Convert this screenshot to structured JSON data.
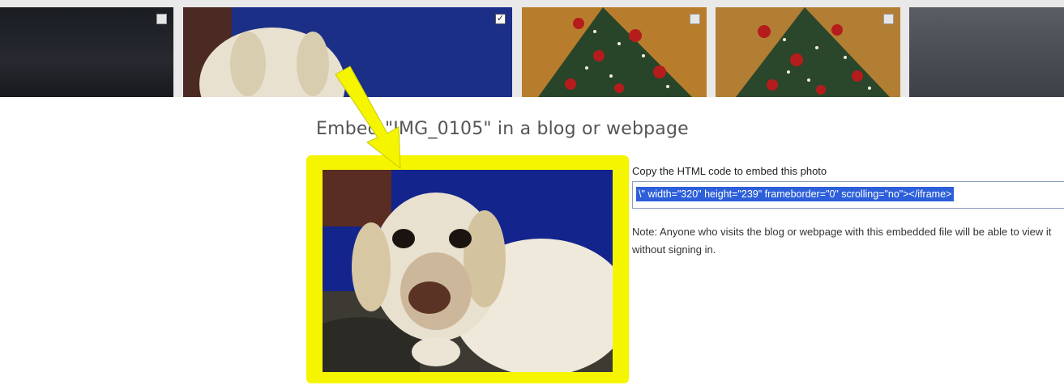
{
  "thumbnails": [
    {
      "selected": false,
      "subject": "dark-room-photo"
    },
    {
      "selected": true,
      "subject": "dog-photo"
    },
    {
      "selected": false,
      "subject": "christmas-tree-photo"
    },
    {
      "selected": false,
      "subject": "christmas-tree-photo"
    },
    {
      "selected": false,
      "subject": "room-photo"
    }
  ],
  "embed": {
    "title": "Embed \"IMG_0105\" in a blog or webpage",
    "code_label": "Copy the HTML code to embed this photo",
    "code_value": "\\\" width=\"320\" height=\"239\" frameborder=\"0\" scrolling=\"no\"></iframe>",
    "note": "Note: Anyone who visits the blog or webpage with this embedded file will be able to view it without signing in."
  },
  "annotation": {
    "highlight_color": "#f5f500",
    "arrow_color": "#f5f500"
  },
  "colors": {
    "selection_bg": "#2c5fd9",
    "code_border": "#8c9dbf"
  }
}
